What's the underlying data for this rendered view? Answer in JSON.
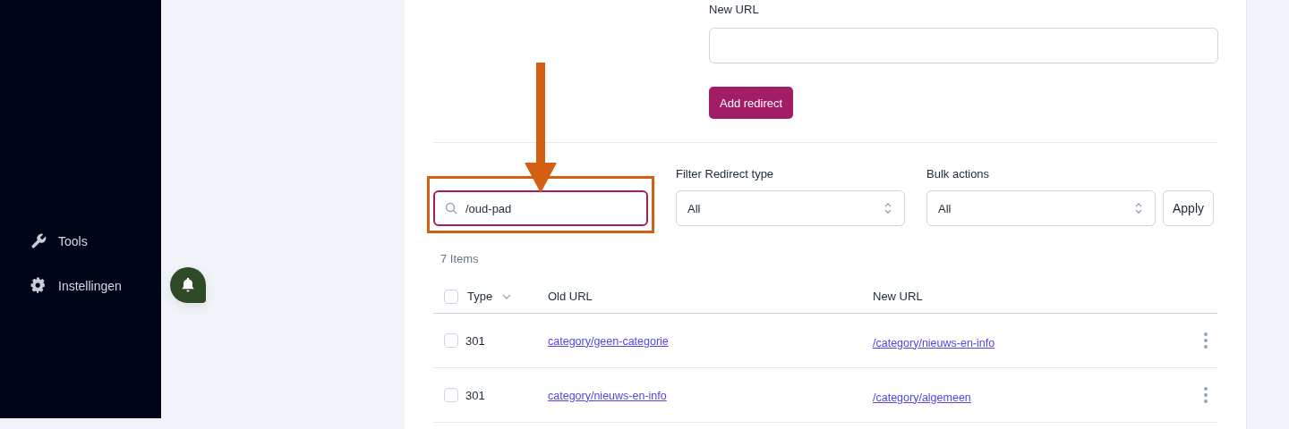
{
  "sidebar": {
    "items": [
      {
        "label": "Tools"
      },
      {
        "label": "Instellingen"
      }
    ]
  },
  "notification_button": {
    "kind": "bell"
  },
  "form": {
    "new_url": {
      "label": "New URL"
    },
    "submit": "Add redirect"
  },
  "filters": {
    "search": {
      "value": "/oud-pad",
      "highlighted": true
    },
    "redirect_type": {
      "label": "Filter Redirect type",
      "value": "All"
    },
    "bulk_actions": {
      "label": "Bulk actions",
      "value": "All"
    },
    "apply": "Apply"
  },
  "item_count": "7 Items",
  "table": {
    "select_all": {
      "checked": false
    },
    "columns": [
      "Type",
      "Old URL",
      "New URL"
    ],
    "rows": [
      {
        "type": "301",
        "old_url": "category/geen-categorie",
        "new_url": "/category/nieuws-en-info",
        "checked": false
      },
      {
        "type": "301",
        "old_url": "category/nieuws-en-info",
        "new_url": "/category/algemeen",
        "checked": false
      }
    ]
  }
}
